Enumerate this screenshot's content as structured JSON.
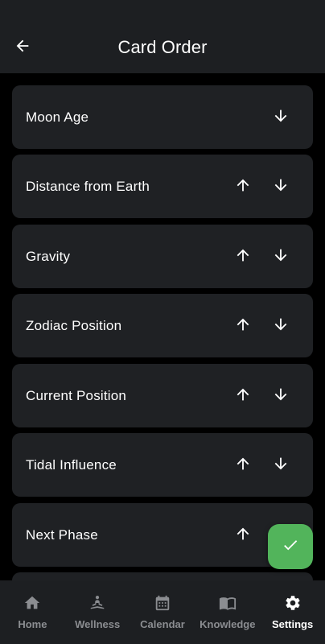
{
  "header": {
    "title": "Card Order",
    "back_icon": "arrow-back-icon"
  },
  "cards": [
    {
      "label": "Moon Age",
      "has_up": false,
      "has_down": true
    },
    {
      "label": "Distance from Earth",
      "has_up": true,
      "has_down": true
    },
    {
      "label": "Gravity",
      "has_up": true,
      "has_down": true
    },
    {
      "label": "Zodiac Position",
      "has_up": true,
      "has_down": true
    },
    {
      "label": "Current Position",
      "has_up": true,
      "has_down": true
    },
    {
      "label": "Tidal Influence",
      "has_up": true,
      "has_down": true
    },
    {
      "label": "Next Phase",
      "has_up": true,
      "has_down": true
    },
    {
      "label": "",
      "has_up": false,
      "has_down": false
    }
  ],
  "fab": {
    "icon": "check-icon",
    "color": "#52b45b"
  },
  "bottom_nav": {
    "items": [
      {
        "label": "Home",
        "icon": "home-icon",
        "active": false
      },
      {
        "label": "Wellness",
        "icon": "meditation-icon",
        "active": false
      },
      {
        "label": "Calendar",
        "icon": "calendar-icon",
        "active": false
      },
      {
        "label": "Knowledge",
        "icon": "book-icon",
        "active": false
      },
      {
        "label": "Settings",
        "icon": "gear-icon",
        "active": true
      }
    ]
  },
  "colors": {
    "background": "#000000",
    "surface": "#1f2124",
    "bar": "#1d1f22",
    "inactive": "#8b8d91",
    "accent": "#52b45b"
  }
}
